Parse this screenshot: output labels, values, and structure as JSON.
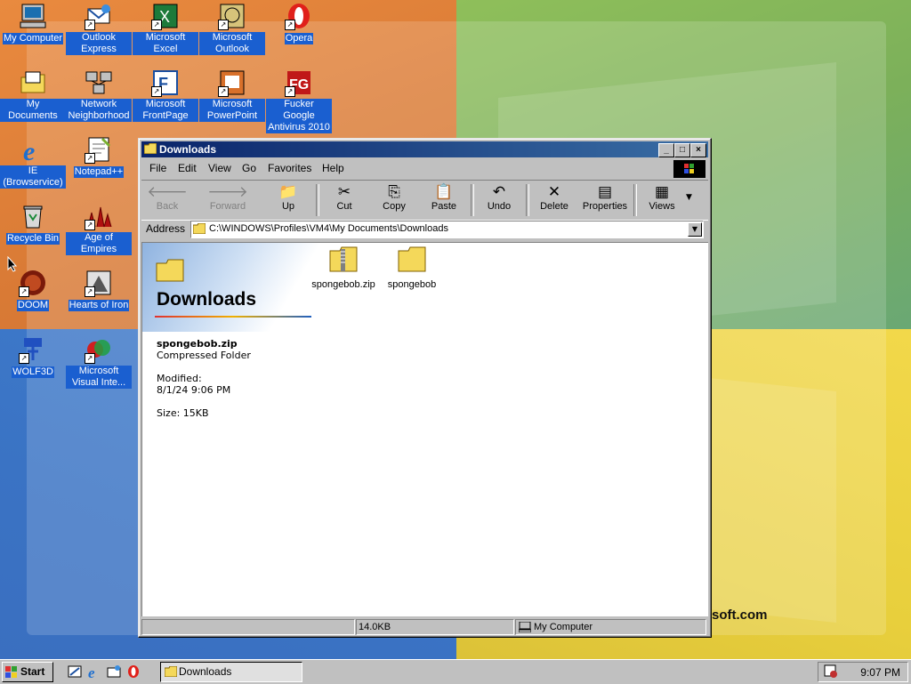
{
  "desktop": {
    "icons": [
      {
        "label": "My Computer",
        "icon": "my-computer-icon"
      },
      {
        "label": "Outlook Express",
        "icon": "outlook-express-icon"
      },
      {
        "label": "Microsoft Excel",
        "icon": "excel-icon"
      },
      {
        "label": "Microsoft Outlook",
        "icon": "outlook-icon"
      },
      {
        "label": "Opera",
        "icon": "opera-icon"
      },
      {
        "label": "My Documents",
        "icon": "my-documents-icon"
      },
      {
        "label": "Network Neighborhood",
        "icon": "network-icon"
      },
      {
        "label": "Microsoft FrontPage",
        "icon": "frontpage-icon"
      },
      {
        "label": "Microsoft PowerPoint",
        "icon": "powerpoint-icon"
      },
      {
        "label": "Fucker Google Antivirus 2010",
        "icon": "antivirus-icon"
      },
      {
        "label": "IE (Browservice)",
        "icon": "ie-icon"
      },
      {
        "label": "Notepad++",
        "icon": "notepad-icon"
      },
      {
        "label": "Recycle Bin",
        "icon": "recycle-bin-icon"
      },
      {
        "label": "Age of Empires",
        "icon": "age-of-empires-icon"
      },
      {
        "label": "DOOM",
        "icon": "doom-icon"
      },
      {
        "label": "Hearts of Iron",
        "icon": "hearts-of-iron-icon"
      },
      {
        "label": "WOLF3D",
        "icon": "wolf3d-icon"
      },
      {
        "label": "Microsoft Visual Inte...",
        "icon": "visual-interdev-icon"
      }
    ],
    "wallpaper_text": "soft.com"
  },
  "window": {
    "title": "Downloads",
    "menu": [
      "File",
      "Edit",
      "View",
      "Go",
      "Favorites",
      "Help"
    ],
    "toolbar": {
      "back": "Back",
      "forward": "Forward",
      "up": "Up",
      "cut": "Cut",
      "copy": "Copy",
      "paste": "Paste",
      "undo": "Undo",
      "delete": "Delete",
      "properties": "Properties",
      "views": "Views"
    },
    "address_label": "Address",
    "address_value": "C:\\WINDOWS\\Profiles\\VM4\\My Documents\\Downloads",
    "banner_title": "Downloads",
    "selected": {
      "name": "spongebob.zip",
      "type": "Compressed Folder",
      "modified_label": "Modified:",
      "modified_value": "8/1/24 9:06 PM",
      "size": "Size: 15KB"
    },
    "files": [
      {
        "name": "spongebob.zip",
        "icon": "zip-folder-icon"
      },
      {
        "name": "spongebob",
        "icon": "folder-icon"
      }
    ],
    "status": {
      "size": "14.0KB",
      "zone": "My Computer"
    }
  },
  "taskbar": {
    "start": "Start",
    "task": "Downloads",
    "time": "9:07 PM"
  }
}
